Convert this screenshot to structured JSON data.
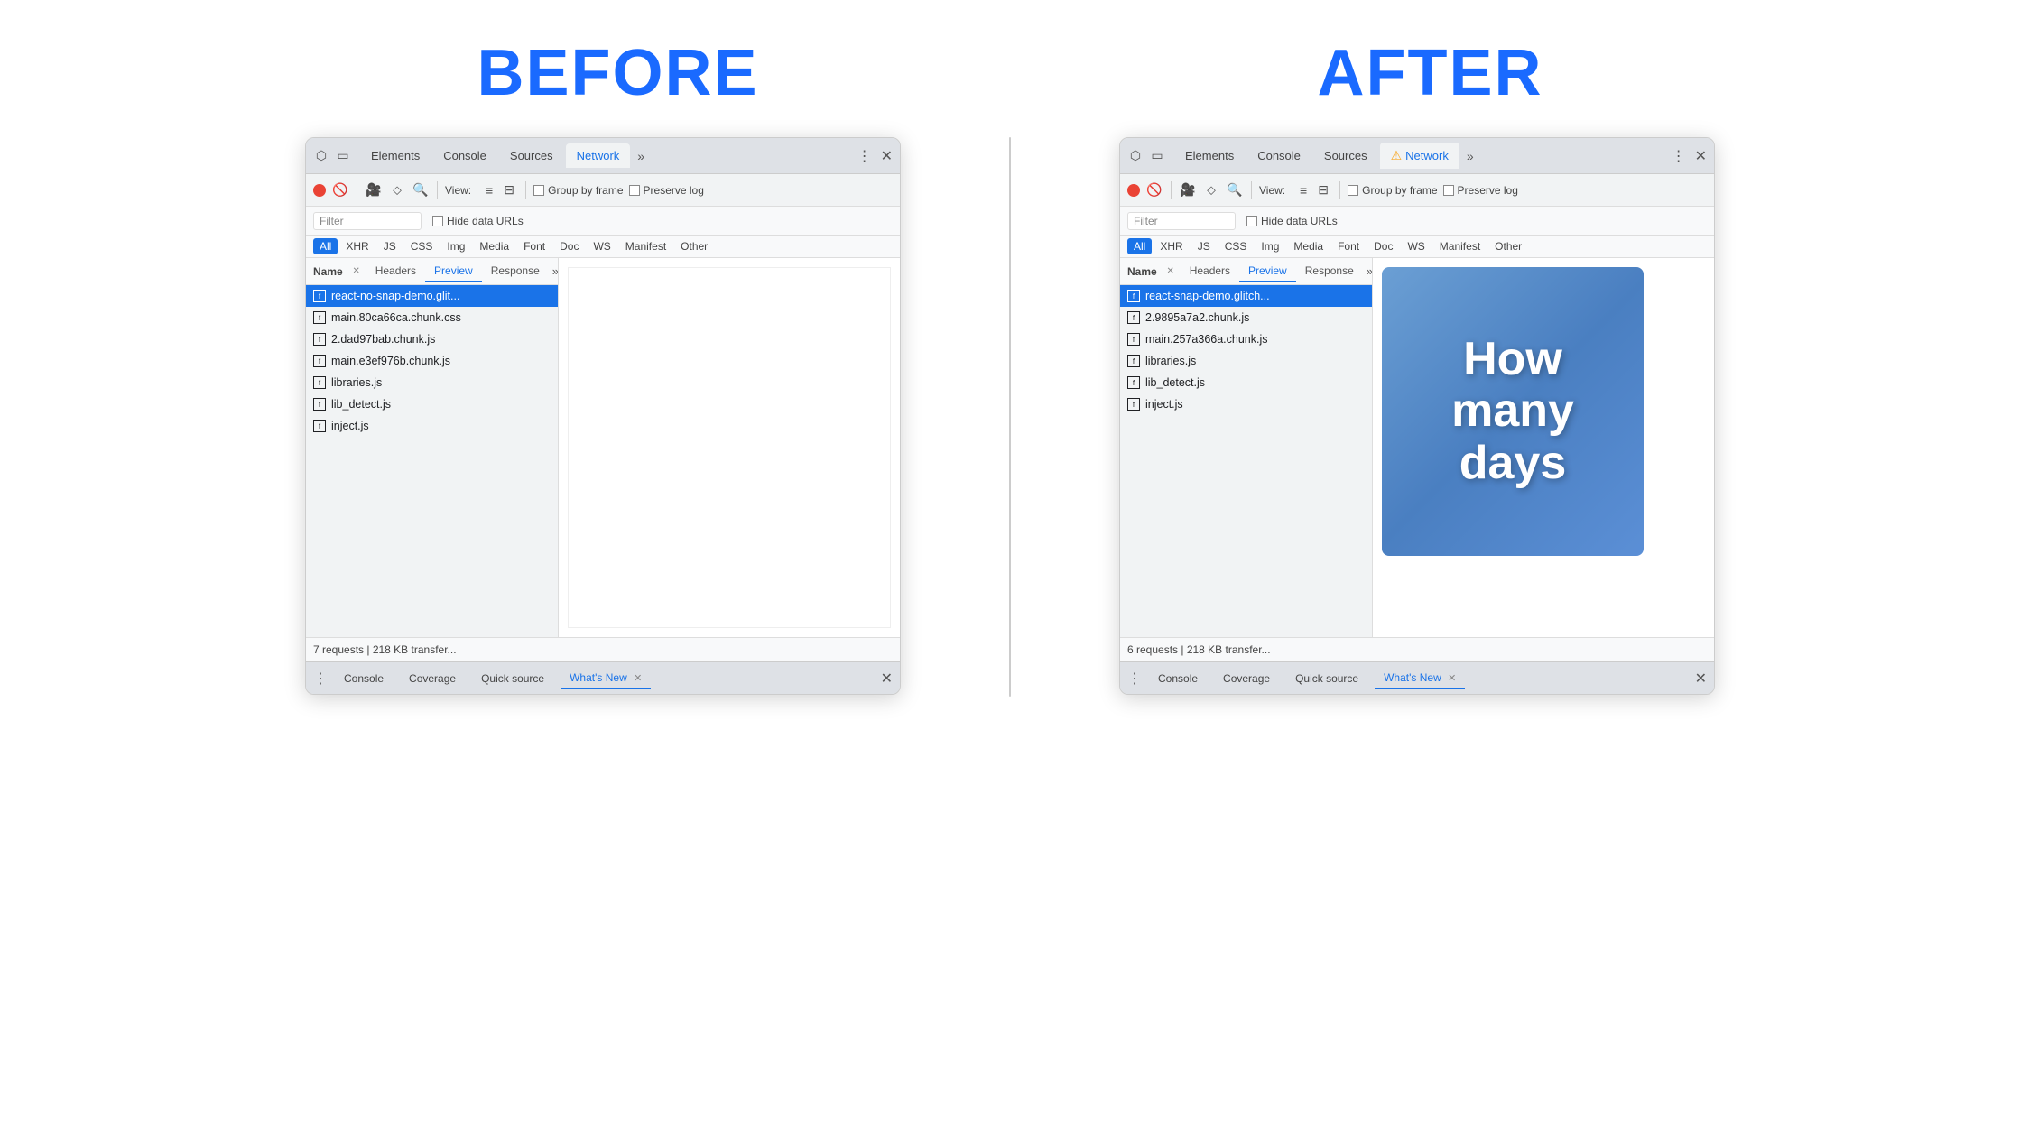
{
  "page": {
    "before_label": "BEFORE",
    "after_label": "AFTER"
  },
  "before": {
    "tabs": [
      {
        "label": "Elements",
        "active": false
      },
      {
        "label": "Console",
        "active": false
      },
      {
        "label": "Sources",
        "active": false
      },
      {
        "label": "Network",
        "active": true
      },
      {
        "label": "»",
        "active": false
      }
    ],
    "toolbar": {
      "view_label": "View:",
      "group_by_frame": "Group by frame",
      "preserve_log": "Preserve log"
    },
    "filter": {
      "placeholder": "Filter",
      "hide_data_urls": "Hide data URLs"
    },
    "filter_types": [
      "All",
      "XHR",
      "JS",
      "CSS",
      "Img",
      "Media",
      "Font",
      "Doc",
      "WS",
      "Manifest",
      "Other"
    ],
    "active_filter": "All",
    "sub_tabs": {
      "name_header": "Name",
      "tabs": [
        "Headers",
        "Preview",
        "Response"
      ],
      "active_tab": "Preview"
    },
    "files": [
      {
        "name": "react-no-snap-demo.glit...",
        "selected": true
      },
      {
        "name": "main.80ca66ca.chunk.css",
        "selected": false
      },
      {
        "name": "2.dad97bab.chunk.js",
        "selected": false
      },
      {
        "name": "main.e3ef976b.chunk.js",
        "selected": false
      },
      {
        "name": "libraries.js",
        "selected": false
      },
      {
        "name": "lib_detect.js",
        "selected": false
      },
      {
        "name": "inject.js",
        "selected": false
      }
    ],
    "status": "7 requests | 218 KB transfer...",
    "drawer_tabs": [
      "Console",
      "Coverage",
      "Quick source",
      "What's New"
    ],
    "active_drawer_tab": "What's New",
    "preview_blank": true
  },
  "after": {
    "tabs": [
      {
        "label": "Elements",
        "active": false
      },
      {
        "label": "Console",
        "active": false
      },
      {
        "label": "Sources",
        "active": false
      },
      {
        "label": "Network",
        "active": true,
        "warning": true
      },
      {
        "label": "»",
        "active": false
      }
    ],
    "toolbar": {
      "view_label": "View:",
      "group_by_frame": "Group by frame",
      "preserve_log": "Preserve log"
    },
    "filter": {
      "placeholder": "Filter",
      "hide_data_urls": "Hide data URLs"
    },
    "filter_types": [
      "All",
      "XHR",
      "JS",
      "CSS",
      "Img",
      "Media",
      "Font",
      "Doc",
      "WS",
      "Manifest",
      "Other"
    ],
    "active_filter": "All",
    "sub_tabs": {
      "name_header": "Name",
      "tabs": [
        "Headers",
        "Preview",
        "Response"
      ],
      "active_tab": "Preview"
    },
    "files": [
      {
        "name": "react-snap-demo.glitch...",
        "selected": true
      },
      {
        "name": "2.9895a7a2.chunk.js",
        "selected": false
      },
      {
        "name": "main.257a366a.chunk.js",
        "selected": false
      },
      {
        "name": "libraries.js",
        "selected": false
      },
      {
        "name": "lib_detect.js",
        "selected": false
      },
      {
        "name": "inject.js",
        "selected": false
      }
    ],
    "status": "6 requests | 218 KB transfer...",
    "drawer_tabs": [
      "Console",
      "Coverage",
      "Quick source",
      "What's New"
    ],
    "active_drawer_tab": "What's New",
    "preview_image": {
      "line1": "How",
      "line2": "many",
      "line3": "days"
    }
  }
}
